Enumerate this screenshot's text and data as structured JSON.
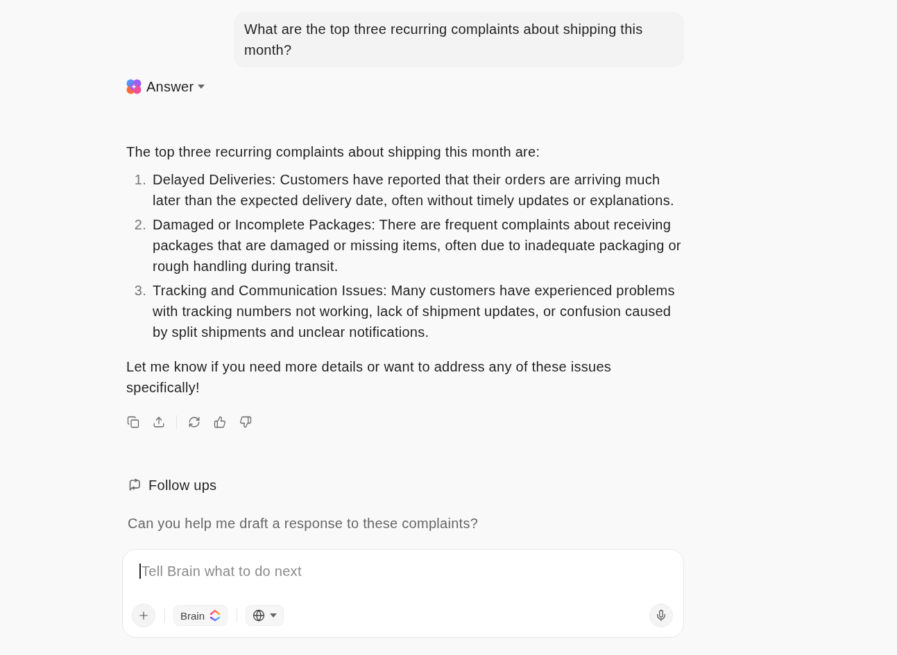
{
  "user_message": {
    "text": "What are the top three recurring complaints about shipping this month?"
  },
  "answer": {
    "label": "Answer",
    "intro": "The top three recurring complaints about shipping this month are:",
    "items": [
      {
        "number": "1.",
        "text": "Delayed Deliveries: Customers have reported that their orders are arriving much later than the expected delivery date, often without timely updates or explanations."
      },
      {
        "number": "2.",
        "text": "Damaged or Incomplete Packages: There are frequent complaints about receiving packages that are damaged or missing items, often due to inadequate packaging or rough handling during transit."
      },
      {
        "number": "3.",
        "text": "Tracking and Communication Issues: Many customers have experienced problems with tracking numbers not working, lack of shipment updates, or confusion caused by split shipments and unclear notifications."
      }
    ],
    "closing": "Let me know if you need more details or want to address any of these issues specifically!"
  },
  "follow_ups": {
    "title": "Follow ups",
    "suggestions": [
      "Can you help me draft a response to these complaints?"
    ]
  },
  "composer": {
    "placeholder": "Tell Brain what to do next",
    "focused": true,
    "model": "Brain"
  }
}
